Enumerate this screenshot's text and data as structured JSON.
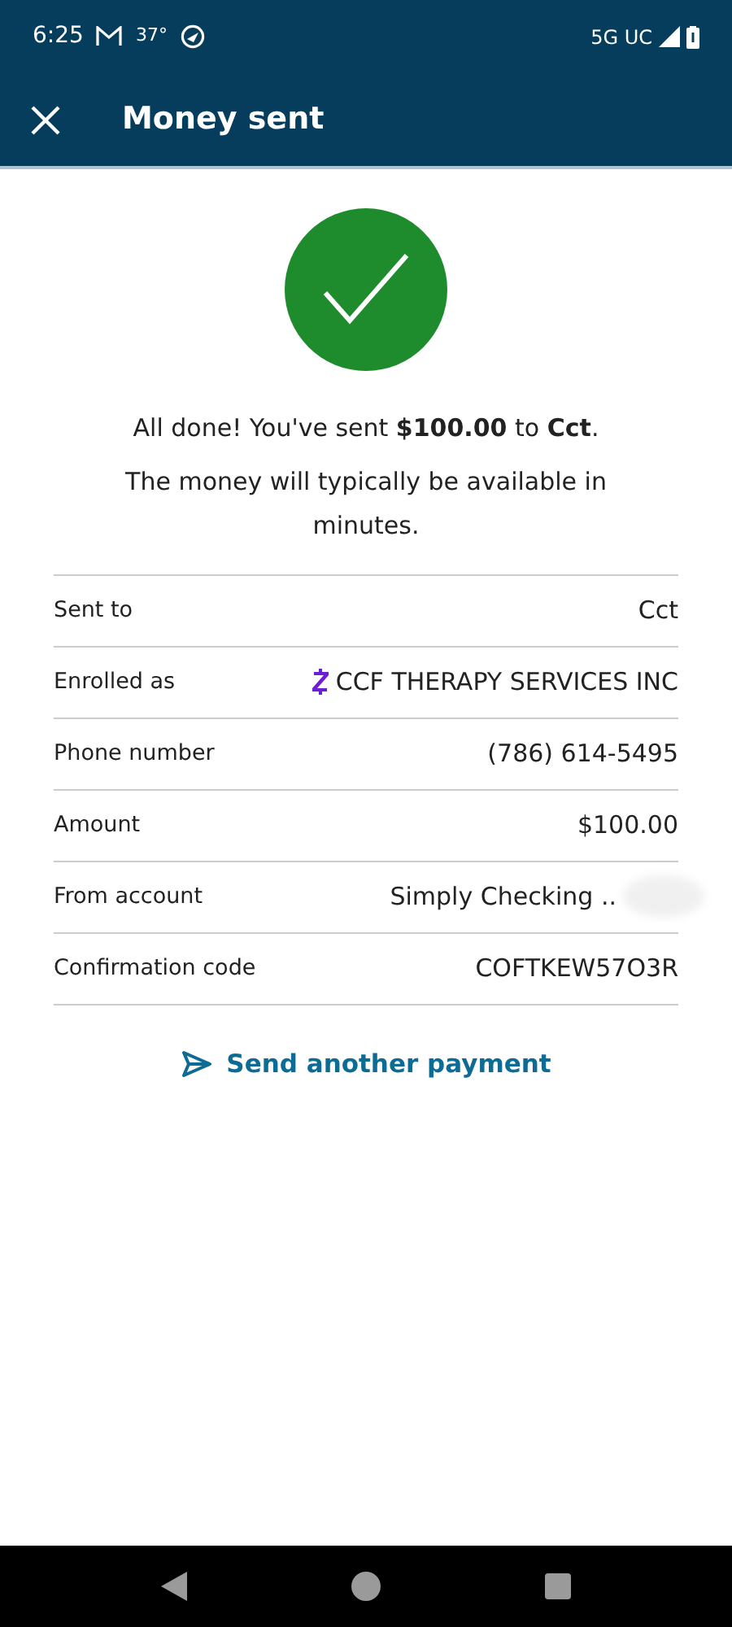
{
  "status_bar": {
    "time": "6:25",
    "temperature": "37°",
    "network": "5G UC"
  },
  "app_bar": {
    "title": "Money sent"
  },
  "message": "All done! You've sent **$100.00** to **Cct**.",
  "note": "The money will typically be available in minutes.",
  "details": [
    {
      "kind": "text",
      "label": "Sent to",
      "value": "Cct"
    },
    {
      "kind": "zelle",
      "label": "Enrolled as",
      "value": "CCF THERAPY SERVICES INC"
    },
    {
      "kind": "text",
      "label": "Phone number",
      "value": "(786) 614-5495"
    },
    {
      "kind": "text",
      "label": "Amount",
      "value": "$100.00"
    },
    {
      "kind": "redacted",
      "label": "From account",
      "value": "Simply Checking .."
    },
    {
      "kind": "text",
      "label": "Confirmation code",
      "value": "COFTKEW57O3R"
    }
  ],
  "action": "Send another payment"
}
